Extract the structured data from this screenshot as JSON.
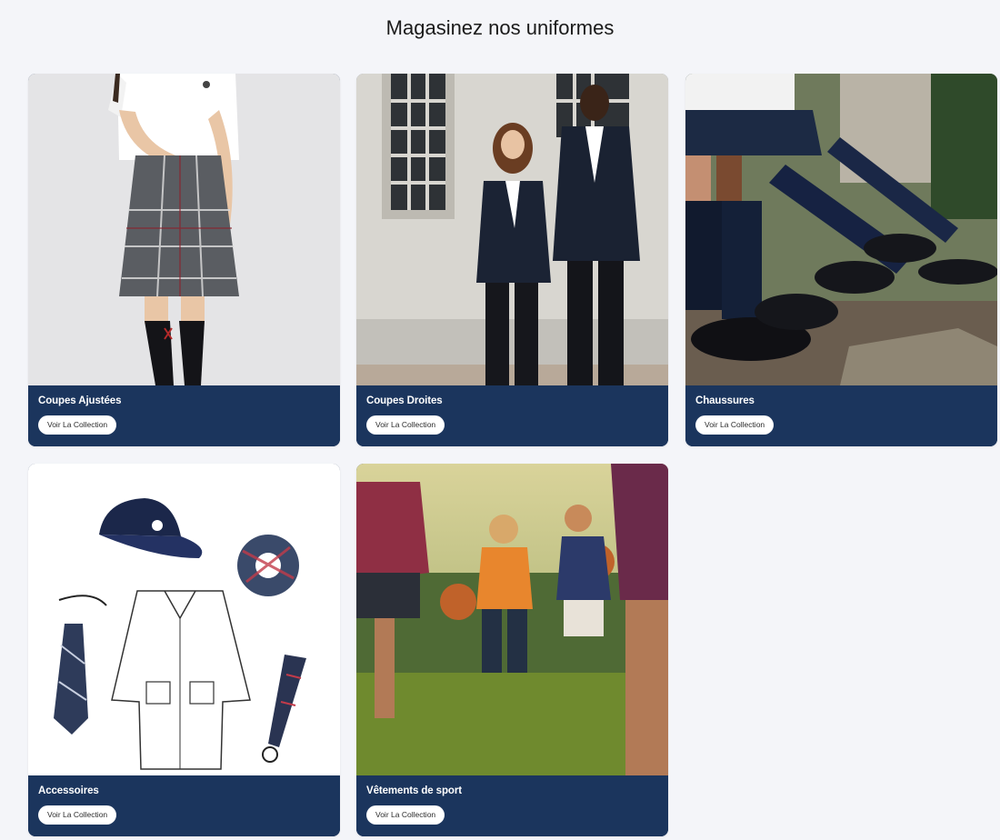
{
  "page": {
    "title": "Magasinez nos uniformes"
  },
  "categories": [
    {
      "title": "Coupes Ajustées",
      "cta": "Voir La Collection"
    },
    {
      "title": "Coupes Droites",
      "cta": "Voir La Collection"
    },
    {
      "title": "Chaussures",
      "cta": "Voir La Collection"
    },
    {
      "title": "Accessoires",
      "cta": "Voir La Collection"
    },
    {
      "title": "Vêtements de sport",
      "cta": "Voir La Collection"
    }
  ],
  "colors": {
    "card_footer": "#1b355d",
    "page_background": "#f4f5f9",
    "button_background": "#ffffff"
  }
}
